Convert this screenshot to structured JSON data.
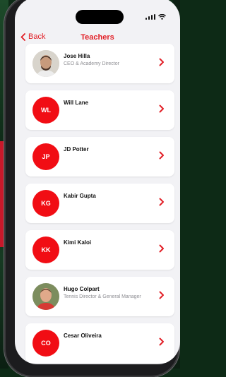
{
  "nav": {
    "back_label": "Back",
    "title": "Teachers"
  },
  "teachers": [
    {
      "name": "Jose Hilla",
      "role": "CEO & Academy Director",
      "initials": "",
      "photo": "person-photo"
    },
    {
      "name": "Will Lane",
      "role": "",
      "initials": "WL"
    },
    {
      "name": "JD Potter",
      "role": "",
      "initials": "JP"
    },
    {
      "name": "Kabir Gupta",
      "role": "",
      "initials": "KG"
    },
    {
      "name": "Kimi Kaloi",
      "role": "",
      "initials": "KK"
    },
    {
      "name": "Hugo Colpart",
      "role": "Tennis Director & General Manager",
      "initials": "",
      "photo": "person-photo"
    },
    {
      "name": "Cesar Oliveira",
      "role": "",
      "initials": "CO"
    }
  ],
  "colors": {
    "accent": "#e21f26",
    "avatar": "#f10d14"
  },
  "icons": {
    "back": "chevron-left-icon",
    "row": "chevron-right-icon",
    "signal": "signal-icon",
    "wifi": "wifi-icon"
  }
}
